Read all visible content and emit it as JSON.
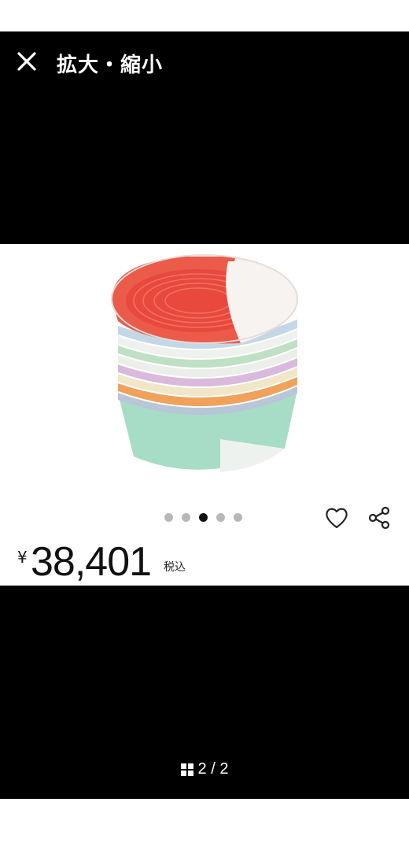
{
  "header": {
    "title": "拡大・縮小",
    "close_icon": "close-icon"
  },
  "product": {
    "image_alt": "stacked colorful bowls",
    "carousel": {
      "count": 5,
      "active_index": 2
    },
    "favorite_icon": "heart-outline-icon",
    "share_icon": "share-icon",
    "currency_symbol": "¥",
    "price": "38,401",
    "tax_label": "税込"
  },
  "pager": {
    "icon": "grid-icon",
    "text": "2 / 2"
  },
  "colors": {
    "background": "#000000",
    "card": "#ffffff",
    "dot_active": "#111111",
    "dot_inactive": "#b8b8b8"
  }
}
